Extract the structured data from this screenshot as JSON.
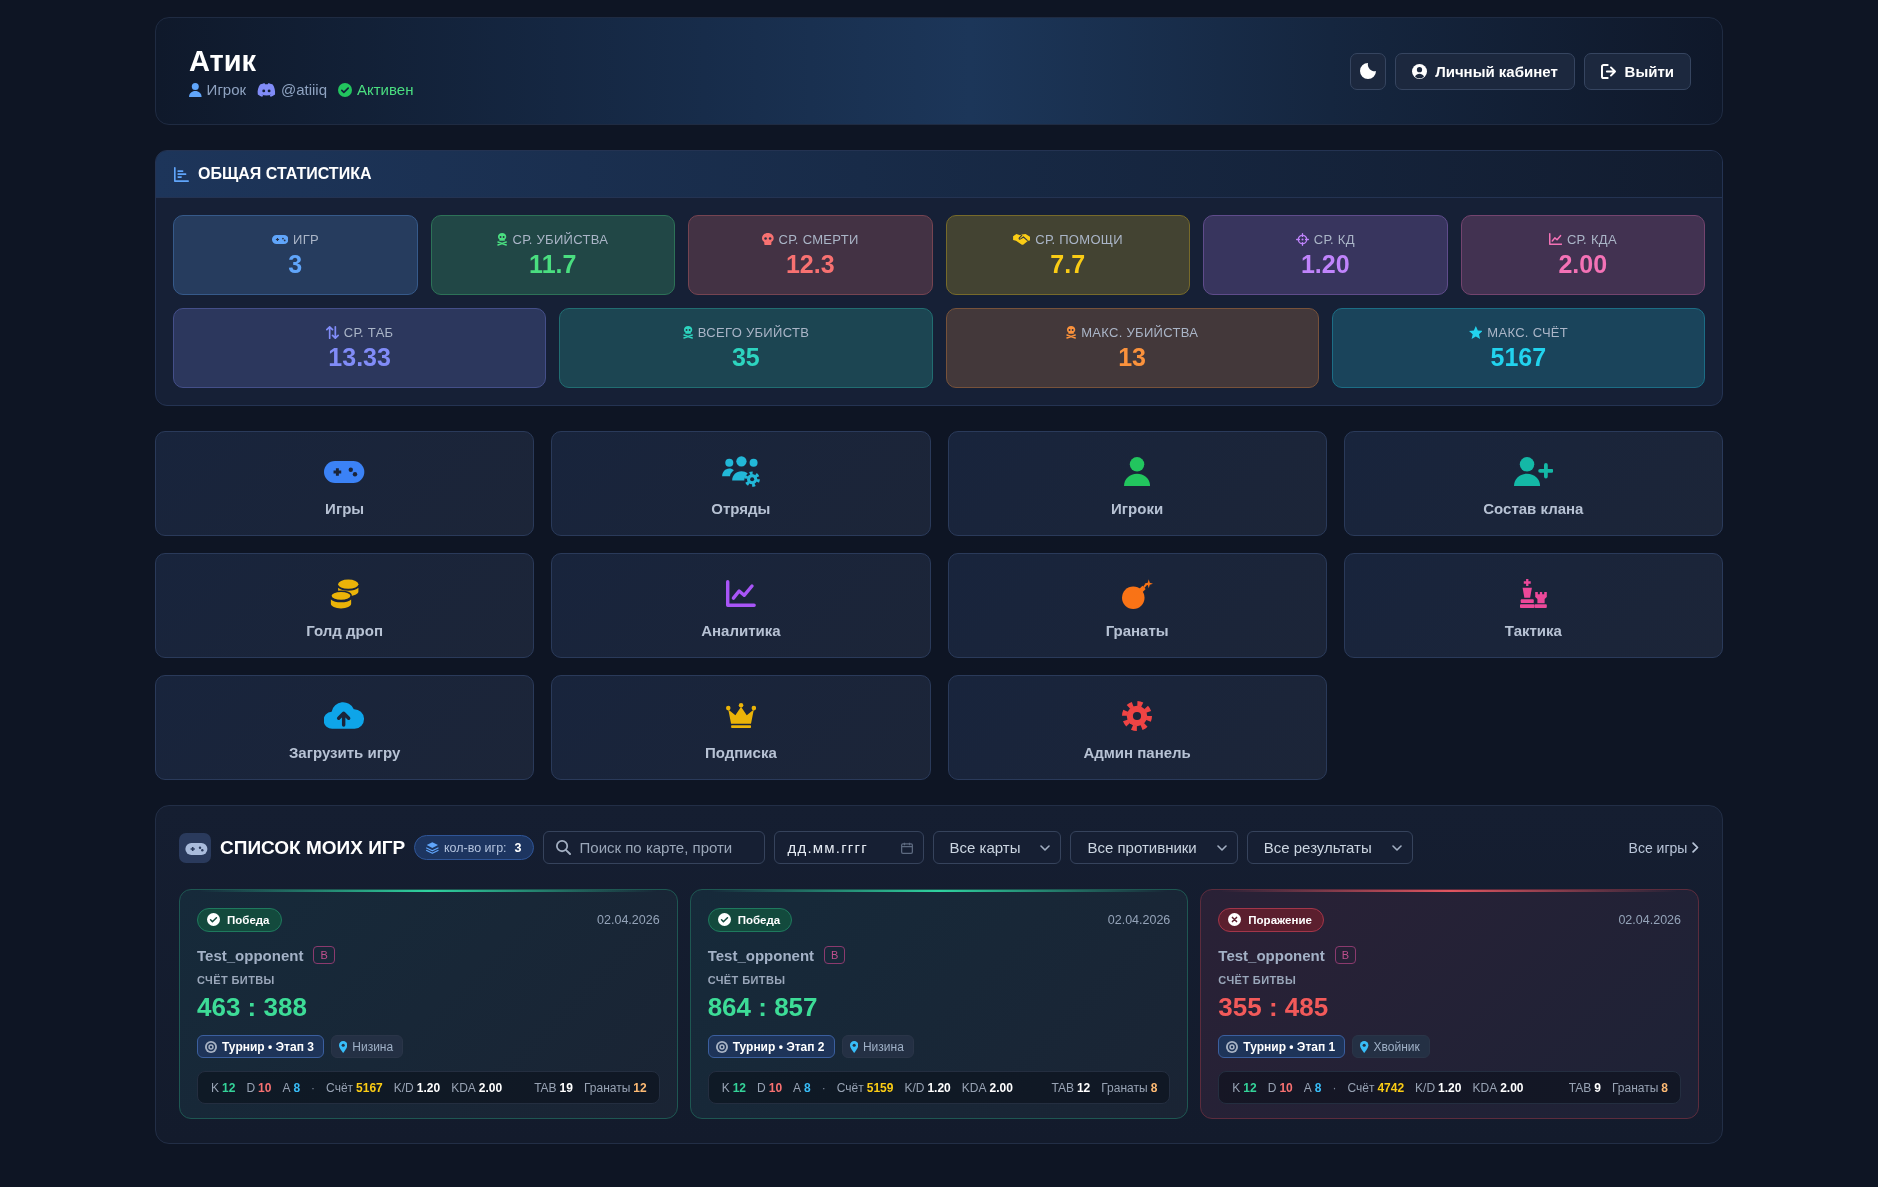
{
  "header": {
    "title": "Атик",
    "meta": [
      {
        "kind": "role",
        "text": "Игрок"
      },
      {
        "kind": "handle",
        "text": "@atiiiq"
      },
      {
        "kind": "status",
        "text": "Активен"
      }
    ],
    "buttons": [
      {
        "kind": "theme"
      },
      {
        "kind": "account",
        "label": "Личный кабинет"
      },
      {
        "kind": "logout",
        "label": "Выйти"
      }
    ]
  },
  "stats": {
    "title": "ОБЩАЯ СТАТИСТИКА",
    "rows": [
      [
        {
          "label": "ИГР",
          "value": "3",
          "color": "#60a5fa"
        },
        {
          "label": "СР. УБИЙСТВА",
          "value": "11.7",
          "color": "#4ade80"
        },
        {
          "label": "СР. СМЕРТИ",
          "value": "12.3",
          "color": "#f87171"
        },
        {
          "label": "СР. ПОМОЩИ",
          "value": "7.7",
          "color": "#facc15"
        },
        {
          "label": "СР. КД",
          "value": "1.20",
          "color": "#c084fc"
        },
        {
          "label": "СР. КДА",
          "value": "2.00",
          "color": "#f472b6"
        }
      ],
      [
        {
          "label": "СР. ТАБ",
          "value": "13.33",
          "color": "#818cf8"
        },
        {
          "label": "ВСЕГО УБИЙСТВ",
          "value": "35",
          "color": "#2dd4bf"
        },
        {
          "label": "МАКС. УБИЙСТВА",
          "value": "13",
          "color": "#fb923c"
        },
        {
          "label": "МАКС. СЧЁТ",
          "value": "5167",
          "color": "#22d3ee"
        }
      ]
    ]
  },
  "tiles": [
    {
      "label": "Игры",
      "color": "#3b82f6"
    },
    {
      "label": "Отряды",
      "color": "#22b8d8"
    },
    {
      "label": "Игроки",
      "color": "#22c55e"
    },
    {
      "label": "Состав клана",
      "color": "#14b8a6"
    },
    {
      "label": "Голд дроп",
      "color": "#eab308"
    },
    {
      "label": "Аналитика",
      "color": "#a855f7"
    },
    {
      "label": "Гранаты",
      "color": "#f97316"
    },
    {
      "label": "Тактика",
      "color": "#ec4899"
    },
    {
      "label": "Загрузить игру",
      "color": "#0ea5e9"
    },
    {
      "label": "Подписка",
      "color": "#eab308"
    },
    {
      "label": "Админ панель",
      "color": "#ef4444"
    }
  ],
  "games": {
    "title": "СПИСОК МОИХ ИГР",
    "count_badge": {
      "label": "кол-во игр:",
      "value": "3"
    },
    "search": {
      "placeholder": "Поиск по карте, проти"
    },
    "date_filter": {
      "placeholder": "дд.мм.гггг"
    },
    "filters": [
      "Все карты",
      "Все противники",
      "Все результаты"
    ],
    "all_link": "Все игры",
    "cards": [
      {
        "kind": "win",
        "result": "Победа",
        "date": "02.04.2026",
        "opponent": "Test_opponent",
        "opponent_badge": "В",
        "score_label": "СЧЁТ БИТВЫ",
        "score": "463 : 388",
        "tags": [
          {
            "kind": "tournament",
            "text": "Турнир • Этап 3"
          },
          {
            "kind": "map",
            "text": "Низина"
          }
        ],
        "stats": {
          "main": [
            {
              "label": "K",
              "value": "12",
              "color": "#34d399"
            },
            {
              "label": "D",
              "value": "10",
              "color": "#f87171"
            },
            {
              "label": "A",
              "value": "8",
              "color": "#38bdf8"
            }
          ],
          "separator": "·",
          "extra": [
            {
              "label": "Счёт",
              "value": "5167",
              "color": "#facc15"
            },
            {
              "label": "K/D",
              "value": "1.20",
              "color": "#ffffff"
            },
            {
              "label": "KDA",
              "value": "2.00",
              "color": "#ffffff"
            }
          ],
          "right": [
            {
              "label": "TAB",
              "value": "19",
              "color": "#ffffff"
            },
            {
              "label": "Гранаты",
              "value": "12",
              "color": "#fdba74"
            }
          ]
        }
      },
      {
        "kind": "win",
        "result": "Победа",
        "date": "02.04.2026",
        "opponent": "Test_opponent",
        "opponent_badge": "В",
        "score_label": "СЧЁТ БИТВЫ",
        "score": "864 : 857",
        "tags": [
          {
            "kind": "tournament",
            "text": "Турнир • Этап 2"
          },
          {
            "kind": "map",
            "text": "Низина"
          }
        ],
        "stats": {
          "main": [
            {
              "label": "K",
              "value": "12",
              "color": "#34d399"
            },
            {
              "label": "D",
              "value": "10",
              "color": "#f87171"
            },
            {
              "label": "A",
              "value": "8",
              "color": "#38bdf8"
            }
          ],
          "separator": "·",
          "extra": [
            {
              "label": "Счёт",
              "value": "5159",
              "color": "#facc15"
            },
            {
              "label": "K/D",
              "value": "1.20",
              "color": "#ffffff"
            },
            {
              "label": "KDA",
              "value": "2.00",
              "color": "#ffffff"
            }
          ],
          "right": [
            {
              "label": "TAB",
              "value": "12",
              "color": "#ffffff"
            },
            {
              "label": "Гранаты",
              "value": "8",
              "color": "#fdba74"
            }
          ]
        }
      },
      {
        "kind": "loss",
        "result": "Поражение",
        "date": "02.04.2026",
        "opponent": "Test_opponent",
        "opponent_badge": "В",
        "score_label": "СЧЁТ БИТВЫ",
        "score": "355 : 485",
        "tags": [
          {
            "kind": "tournament",
            "text": "Турнир • Этап 1"
          },
          {
            "kind": "map",
            "text": "Хвойник"
          }
        ],
        "stats": {
          "main": [
            {
              "label": "K",
              "value": "12",
              "color": "#34d399"
            },
            {
              "label": "D",
              "value": "10",
              "color": "#f87171"
            },
            {
              "label": "A",
              "value": "8",
              "color": "#38bdf8"
            }
          ],
          "separator": "·",
          "extra": [
            {
              "label": "Счёт",
              "value": "4742",
              "color": "#facc15"
            },
            {
              "label": "K/D",
              "value": "1.20",
              "color": "#ffffff"
            },
            {
              "label": "KDA",
              "value": "2.00",
              "color": "#ffffff"
            }
          ],
          "right": [
            {
              "label": "TAB",
              "value": "9",
              "color": "#ffffff"
            },
            {
              "label": "Гранаты",
              "value": "8",
              "color": "#fdba74"
            }
          ]
        }
      }
    ]
  }
}
